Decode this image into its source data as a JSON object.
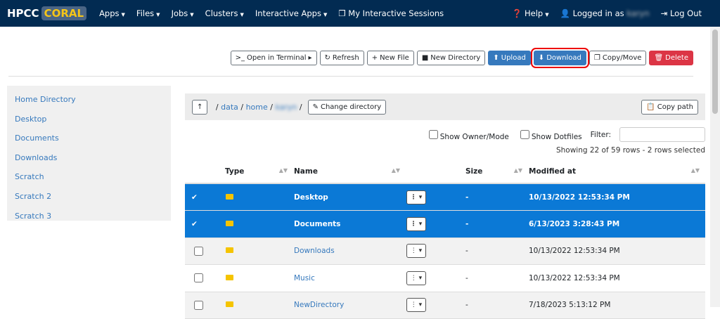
{
  "nav": {
    "logo_a": "HPCC",
    "logo_b": "CORAL",
    "items": [
      "Apps",
      "Files",
      "Jobs",
      "Clusters",
      "Interactive Apps"
    ],
    "sessions": "My Interactive Sessions",
    "help": "Help",
    "logged": "Logged in as",
    "user": "karyn",
    "logout": "Log Out"
  },
  "toolbar": {
    "terminal": "Open in Terminal",
    "refresh": "Refresh",
    "new_file": "New File",
    "new_dir": "New Directory",
    "upload": "Upload",
    "download": "Download",
    "copy_move": "Copy/Move",
    "delete": "Delete"
  },
  "sidebar": [
    "Home Directory",
    "Desktop",
    "Documents",
    "Downloads",
    "Scratch",
    "Scratch 2",
    "Scratch 3"
  ],
  "crumb": {
    "parts": [
      "data",
      "home",
      "karyn"
    ],
    "change": "Change directory",
    "copy": "Copy path"
  },
  "options": {
    "owner": "Show Owner/Mode",
    "dotfiles": "Show Dotfiles",
    "filter": "Filter:",
    "count": "Showing 22 of 59 rows - 2 rows selected"
  },
  "table": {
    "headers": [
      "Type",
      "Name",
      "Size",
      "Modified at"
    ],
    "rows": [
      {
        "name": "Desktop",
        "size": "-",
        "modified": "10/13/2022 12:53:34 PM",
        "selected": true
      },
      {
        "name": "Documents",
        "size": "-",
        "modified": "6/13/2023 3:28:43 PM",
        "selected": true
      },
      {
        "name": "Downloads",
        "size": "-",
        "modified": "10/13/2022 12:53:34 PM",
        "selected": false
      },
      {
        "name": "Music",
        "size": "-",
        "modified": "10/13/2022 12:53:34 PM",
        "selected": false
      },
      {
        "name": "NewDirectory",
        "size": "-",
        "modified": "7/18/2023 5:13:12 PM",
        "selected": false
      }
    ]
  }
}
